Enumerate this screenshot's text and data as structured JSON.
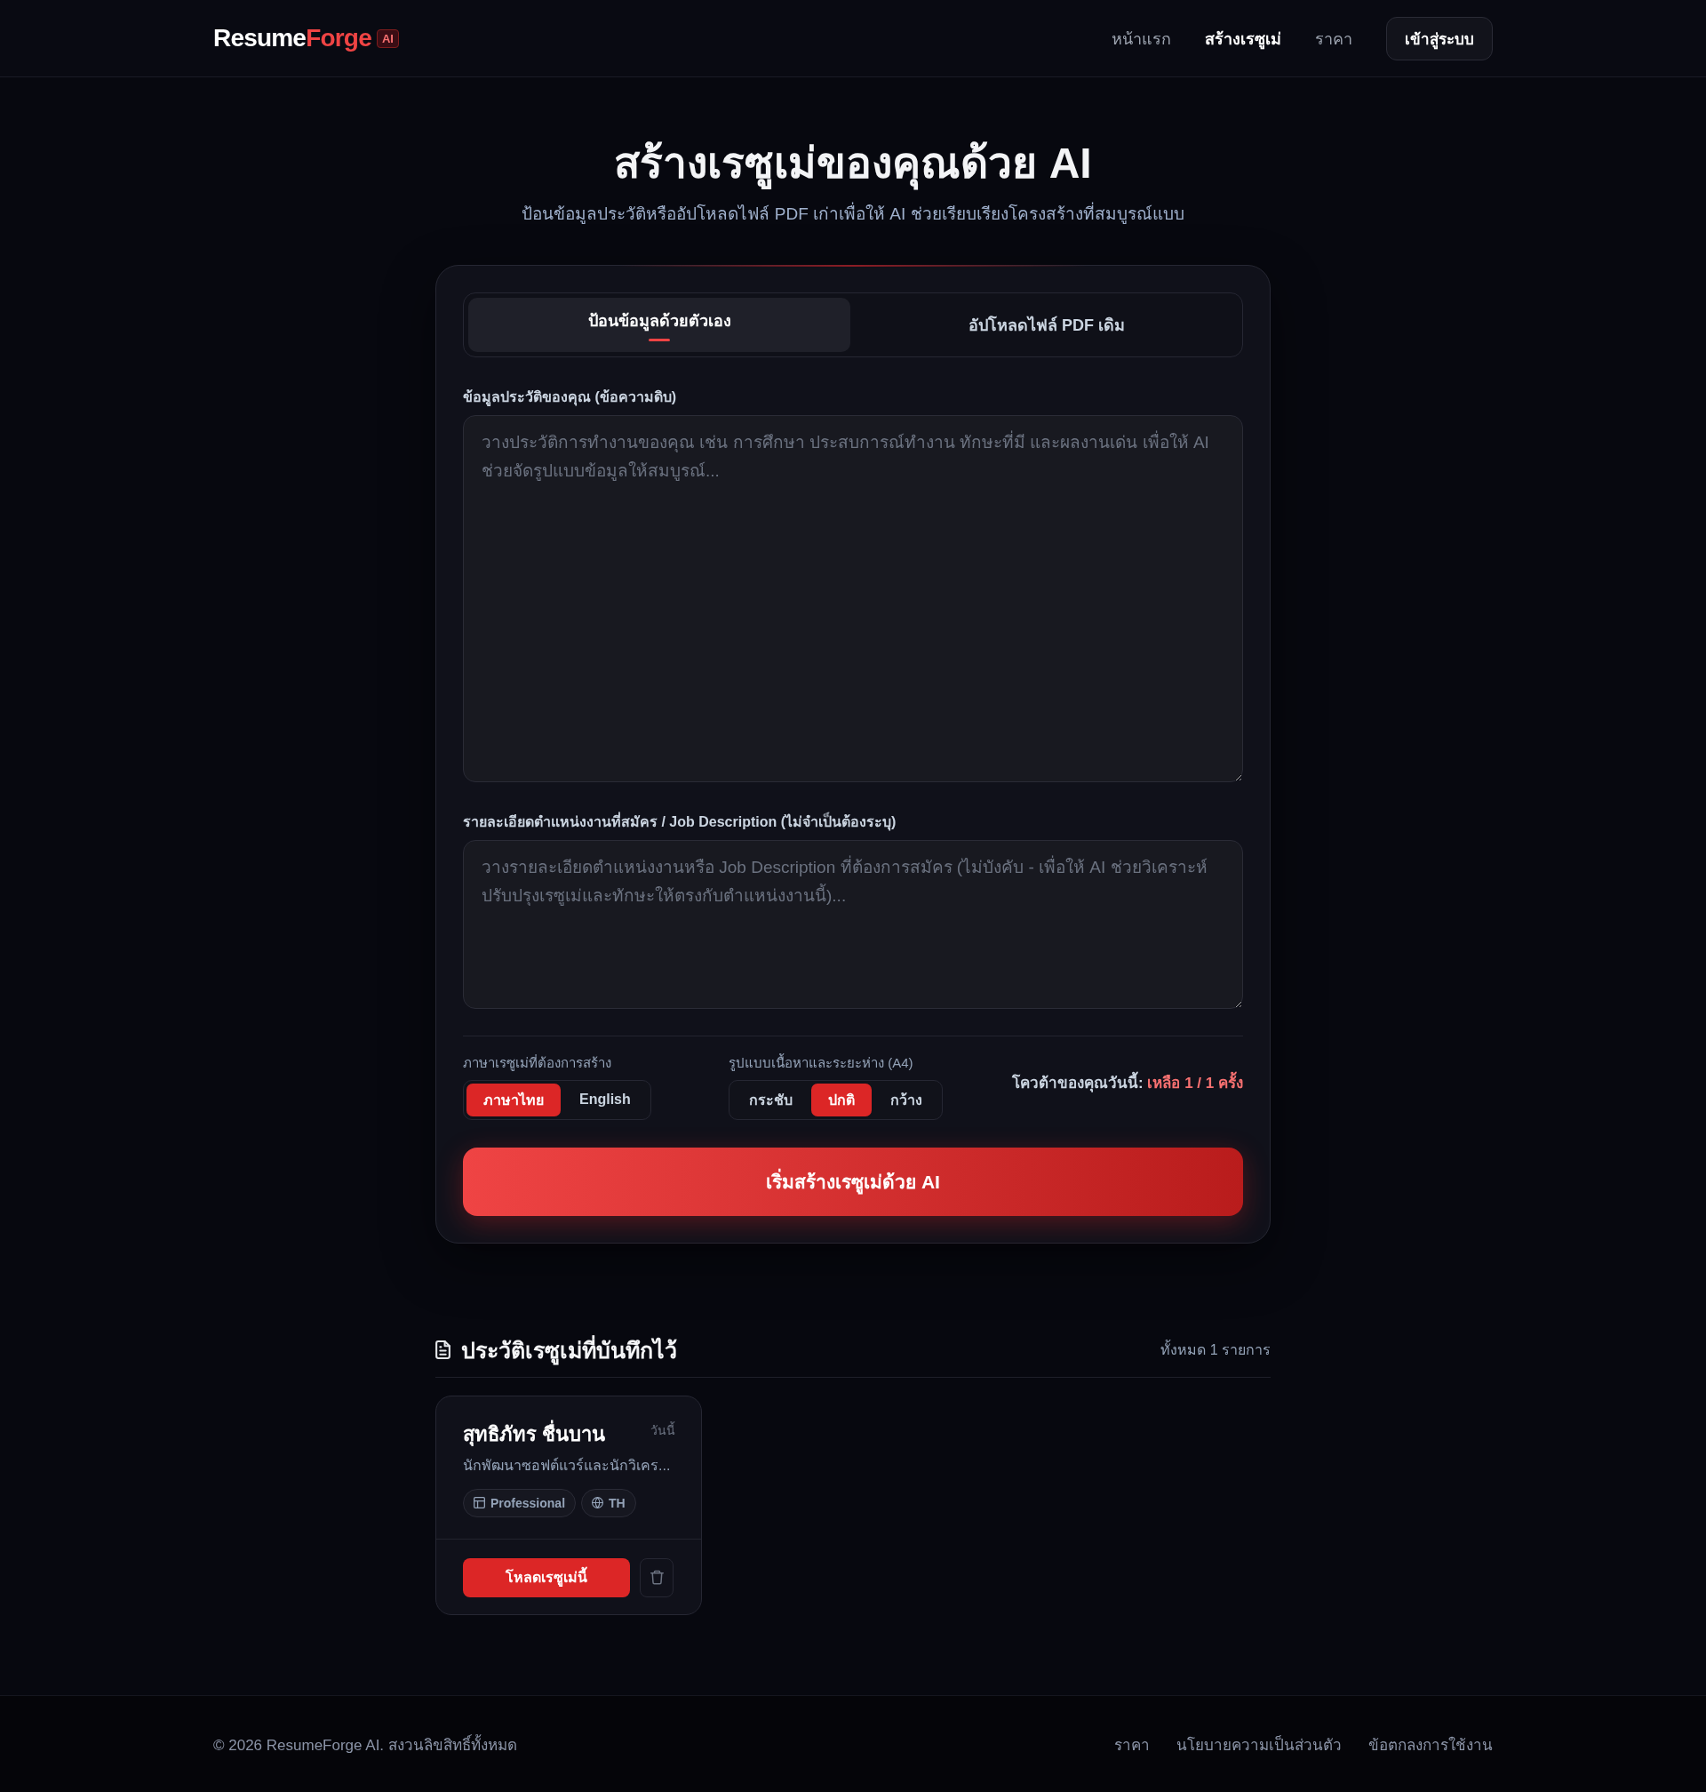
{
  "header": {
    "logo": {
      "name": "Resume",
      "accent": "Forge",
      "badge": "AI"
    },
    "nav": [
      {
        "label": "หน้าแรก",
        "selected": false
      },
      {
        "label": "สร้างเรซูเม่",
        "selected": true
      },
      {
        "label": "ราคา",
        "selected": false
      }
    ],
    "login_button": "เข้าสู่ระบบ"
  },
  "hero": {
    "title": "สร้างเรซูเม่ของคุณด้วย AI",
    "subtitle": "ป้อนข้อมูลประวัติหรืออัปโหลดไฟล์ PDF เก่าเพื่อให้ AI ช่วยเรียบเรียงโครงสร้างที่สมบูรณ์แบบ"
  },
  "form": {
    "tabs": [
      {
        "label": "ป้อนข้อมูลด้วยตัวเอง",
        "selected": true
      },
      {
        "label": "อัปโหลดไฟล์ PDF เดิม",
        "selected": false
      }
    ],
    "profile_field": {
      "label": "ข้อมูลประวัติของคุณ (ข้อความดิบ)",
      "placeholder": "วางประวัติการทำงานของคุณ เช่น การศึกษา ประสบการณ์ทำงาน ทักษะที่มี และผลงานเด่น เพื่อให้ AI ช่วยจัดรูปแบบข้อมูลให้สมบูรณ์..."
    },
    "job_description_field": {
      "label": "รายละเอียดตำแหน่งงานที่สมัคร / Job Description (ไม่จำเป็นต้องระบุ)",
      "placeholder": "วางรายละเอียดตำแหน่งงานหรือ Job Description ที่ต้องการสมัคร (ไม่บังคับ - เพื่อให้ AI ช่วยวิเคราะห์ปรับปรุงเรซูเม่และทักษะให้ตรงกับตำแหน่งงานนี้)..."
    },
    "language": {
      "label": "ภาษาเรซูเม่ที่ต้องการสร้าง",
      "options": [
        {
          "label": "ภาษาไทย",
          "selected": true
        },
        {
          "label": "English",
          "selected": false
        }
      ]
    },
    "layout": {
      "label": "รูปแบบเนื้อหาและระยะห่าง (A4)",
      "options": [
        {
          "label": "กระชับ",
          "selected": false
        },
        {
          "label": "ปกติ",
          "selected": true
        },
        {
          "label": "กว้าง",
          "selected": false
        }
      ]
    },
    "quota": "โควต้าของคุณวันนี้: **เหลือ 1 / 1 ครั้ง**",
    "submit_button": "เริ่มสร้างเรซูเม่ด้วย AI"
  },
  "history": {
    "title": "ประวัติเรซูเม่ที่บันทึกไว้",
    "count": "ทั้งหมด 1 รายการ",
    "items": [
      {
        "name": "สุทธิภัทร ชื่นบาน",
        "date": "วันนี้",
        "summary": "นักพัฒนาซอฟต์แวร์และนักวิเคร...",
        "tags": [
          {
            "kind": "template",
            "label": "Professional"
          },
          {
            "kind": "language",
            "label": "TH"
          }
        ],
        "load_button": "โหลดเรซูเม่นี้"
      }
    ]
  },
  "footer": {
    "copyright": "© 2026 ResumeForge AI. สงวนลิขสิทธิ์ทั้งหมด",
    "links": [
      "ราคา",
      "นโยบายความเป็นส่วนตัว",
      "ข้อตกลงการใช้งาน"
    ]
  }
}
